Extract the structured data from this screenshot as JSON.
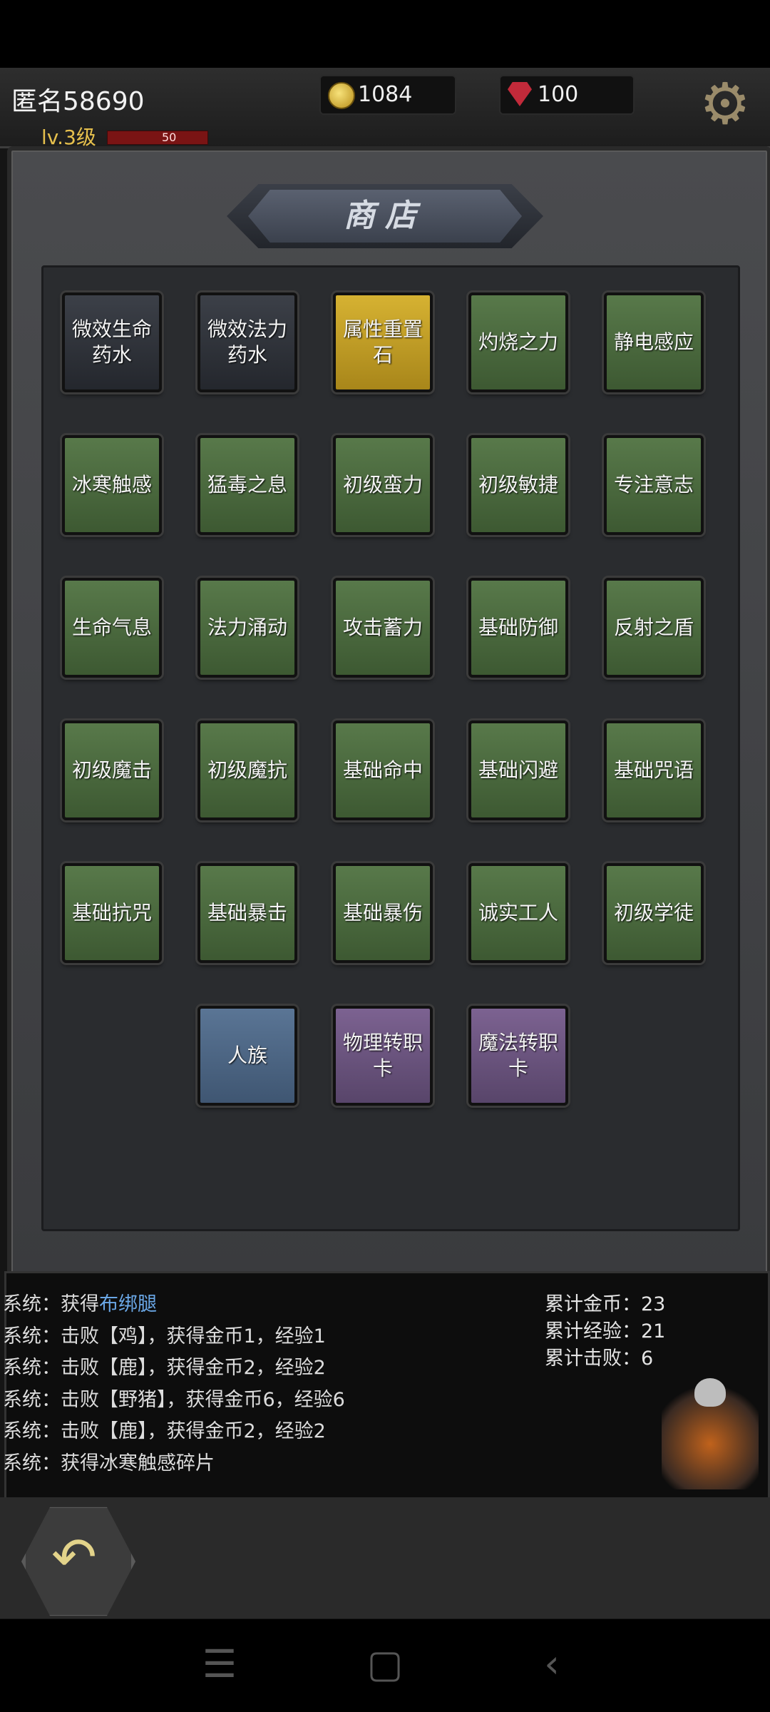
{
  "header": {
    "player_name": "匿名58690",
    "level": "lv.3级",
    "hp_value": "50",
    "gold": "1084",
    "gems": "100"
  },
  "shop": {
    "title": "商店",
    "items": [
      {
        "label": "微效生命药水",
        "color": "dark"
      },
      {
        "label": "微效法力药水",
        "color": "dark"
      },
      {
        "label": "属性重置石",
        "color": "gold"
      },
      {
        "label": "灼烧之力",
        "color": "green"
      },
      {
        "label": "静电感应",
        "color": "green"
      },
      {
        "label": "冰寒触感",
        "color": "green"
      },
      {
        "label": "猛毒之息",
        "color": "green"
      },
      {
        "label": "初级蛮力",
        "color": "green"
      },
      {
        "label": "初级敏捷",
        "color": "green"
      },
      {
        "label": "专注意志",
        "color": "green"
      },
      {
        "label": "生命气息",
        "color": "green"
      },
      {
        "label": "法力涌动",
        "color": "green"
      },
      {
        "label": "攻击蓄力",
        "color": "green"
      },
      {
        "label": "基础防御",
        "color": "green"
      },
      {
        "label": "反射之盾",
        "color": "green"
      },
      {
        "label": "初级魔击",
        "color": "green"
      },
      {
        "label": "初级魔抗",
        "color": "green"
      },
      {
        "label": "基础命中",
        "color": "green"
      },
      {
        "label": "基础闪避",
        "color": "green"
      },
      {
        "label": "基础咒语",
        "color": "green"
      },
      {
        "label": "基础抗咒",
        "color": "green"
      },
      {
        "label": "基础暴击",
        "color": "green"
      },
      {
        "label": "基础暴伤",
        "color": "green"
      },
      {
        "label": "诚实工人",
        "color": "green"
      },
      {
        "label": "初级学徒",
        "color": "green"
      },
      {
        "label": "人族",
        "color": "blue"
      },
      {
        "label": "物理转职卡",
        "color": "purple"
      },
      {
        "label": "魔法转职卡",
        "color": "purple"
      }
    ]
  },
  "log": {
    "lines": [
      {
        "prefix": "系统：获得",
        "highlight": "布绑腿",
        "suffix": ""
      },
      {
        "prefix": "系统：击败【鸡】，获得金币1，经验1",
        "highlight": "",
        "suffix": ""
      },
      {
        "prefix": "系统：击败【鹿】，获得金币2，经验2",
        "highlight": "",
        "suffix": ""
      },
      {
        "prefix": "系统：击败【野猪】，获得金币6，经验6",
        "highlight": "",
        "suffix": ""
      },
      {
        "prefix": "系统：击败【鹿】，获得金币2，经验2",
        "highlight": "",
        "suffix": ""
      },
      {
        "prefix": "系统：获得冰寒触感碎片",
        "highlight": "",
        "suffix": ""
      }
    ],
    "stats": [
      "累计金币：23",
      "累计经验：21",
      "累计击败：6"
    ]
  },
  "icons": {
    "settings": "gear-icon",
    "back": "back-arrow-icon",
    "nav_menu": "menu-icon",
    "nav_home": "home-icon",
    "nav_back": "chevron-left-icon"
  }
}
